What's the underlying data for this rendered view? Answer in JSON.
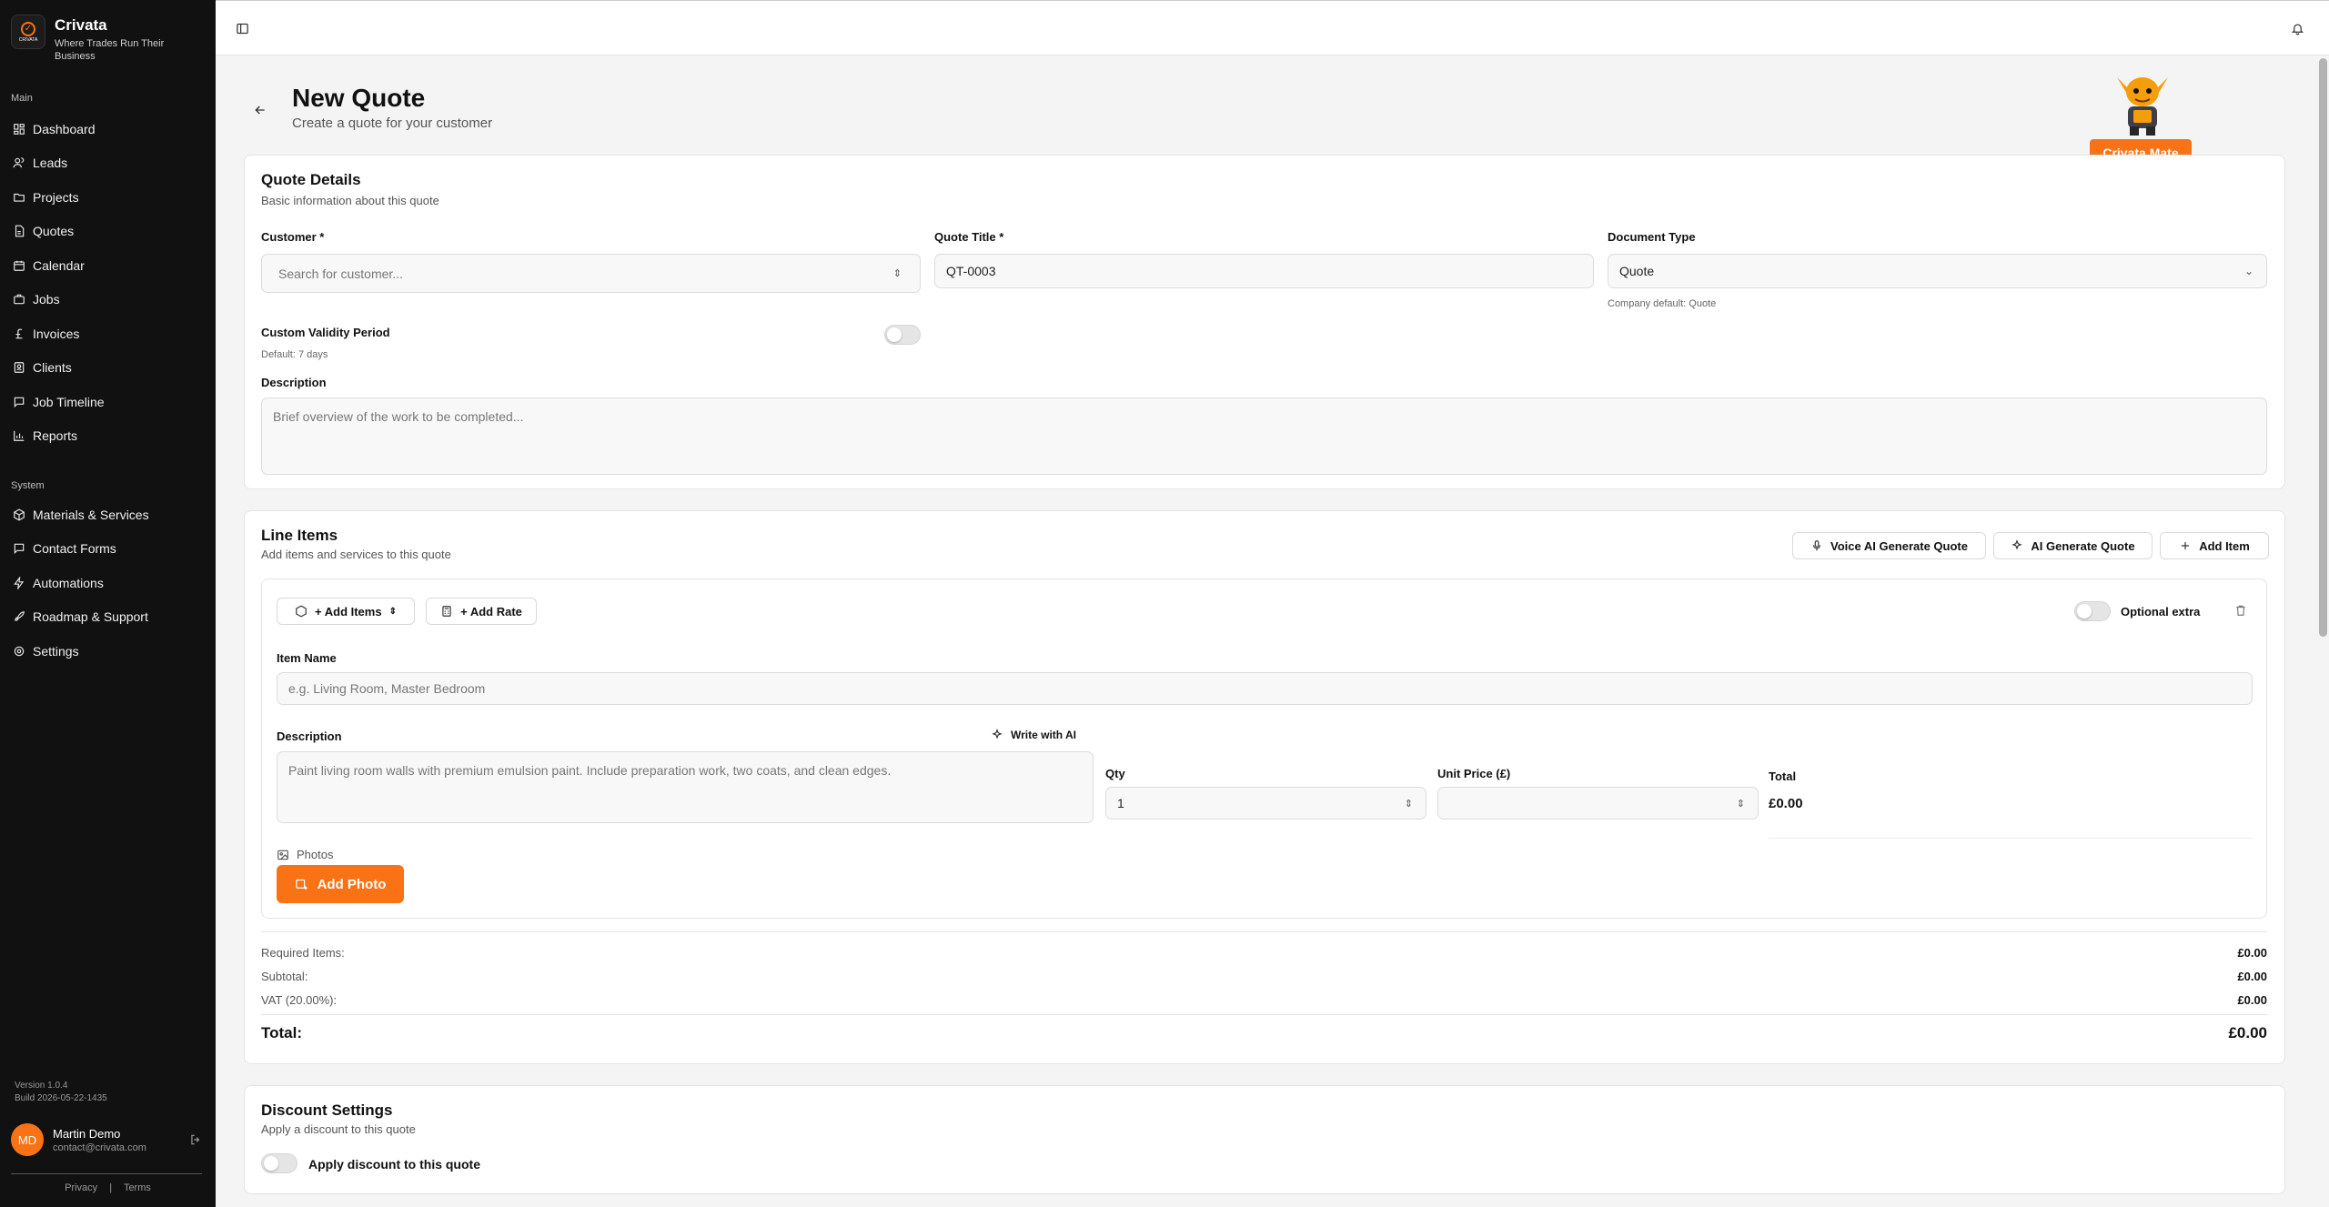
{
  "app": {
    "name": "Crivata",
    "tagline": "Where Trades Run Their Business",
    "logo_mini": "CRIVATA"
  },
  "sidebar": {
    "main_label": "Main",
    "main_items": [
      {
        "label": "Dashboard",
        "icon": "dashboard-icon"
      },
      {
        "label": "Leads",
        "icon": "users-icon"
      },
      {
        "label": "Projects",
        "icon": "folder-icon"
      },
      {
        "label": "Quotes",
        "icon": "file-icon"
      },
      {
        "label": "Calendar",
        "icon": "calendar-icon"
      },
      {
        "label": "Jobs",
        "icon": "briefcase-icon"
      },
      {
        "label": "Invoices",
        "icon": "pound-icon"
      },
      {
        "label": "Clients",
        "icon": "contact-icon"
      },
      {
        "label": "Job Timeline",
        "icon": "chat-icon"
      },
      {
        "label": "Reports",
        "icon": "chart-icon"
      }
    ],
    "system_label": "System",
    "system_items": [
      {
        "label": "Materials & Services",
        "icon": "package-icon"
      },
      {
        "label": "Contact Forms",
        "icon": "message-icon"
      },
      {
        "label": "Automations",
        "icon": "zap-icon"
      },
      {
        "label": "Roadmap & Support",
        "icon": "rocket-icon"
      },
      {
        "label": "Settings",
        "icon": "gear-icon"
      }
    ],
    "version": "Version 1.0.4",
    "build": "Build 2026-05-22-1435",
    "user": {
      "initials": "MD",
      "name": "Martin Demo",
      "email": "contact@crivata.com"
    },
    "footer": {
      "privacy": "Privacy",
      "sep": "|",
      "terms": "Terms"
    }
  },
  "page": {
    "title": "New Quote",
    "subtitle": "Create a quote for your customer",
    "mascot_label": "Crivata Mate"
  },
  "quote_details": {
    "title": "Quote Details",
    "subtitle": "Basic information about this quote",
    "customer_label": "Customer *",
    "customer_placeholder": "Search for customer...",
    "quote_title_label": "Quote Title *",
    "quote_title_value": "QT-0003",
    "doc_type_label": "Document Type",
    "doc_type_value": "Quote",
    "doc_type_hint": "Company default: Quote",
    "validity_label": "Custom Validity Period",
    "validity_hint": "Default: 7 days",
    "validity_enabled": false,
    "description_label": "Description",
    "description_placeholder": "Brief overview of the work to be completed..."
  },
  "line_items": {
    "title": "Line Items",
    "subtitle": "Add items and services to this quote",
    "voice_ai_btn": "Voice AI Generate Quote",
    "ai_btn": "AI Generate Quote",
    "add_item_btn": "Add Item",
    "add_items_btn": "+ Add Items",
    "add_rate_btn": "+ Add Rate",
    "optional_label": "Optional extra",
    "optional_enabled": false,
    "item_name_label": "Item Name",
    "item_name_placeholder": "e.g. Living Room, Master Bedroom",
    "desc_label": "Description",
    "write_ai": "Write with AI",
    "desc_placeholder": "Paint living room walls with premium emulsion paint. Include preparation work, two coats, and clean edges.",
    "qty_label": "Qty",
    "qty_value": "1",
    "unit_price_label": "Unit Price (£)",
    "total_label": "Total",
    "total_value": "£0.00",
    "photos_label": "Photos",
    "add_photo_btn": "Add Photo"
  },
  "totals": {
    "required_label": "Required Items:",
    "required_value": "£0.00",
    "subtotal_label": "Subtotal:",
    "subtotal_value": "£0.00",
    "vat_label": "VAT (20.00%):",
    "vat_value": "£0.00",
    "total_label": "Total:",
    "total_value": "£0.00"
  },
  "discount": {
    "title": "Discount Settings",
    "subtitle": "Apply a discount to this quote",
    "toggle_label": "Apply discount to this quote",
    "enabled": false
  },
  "colors": {
    "accent": "#f97316",
    "sidebar_bg": "#111111",
    "page_bg": "#f4f4f5"
  }
}
